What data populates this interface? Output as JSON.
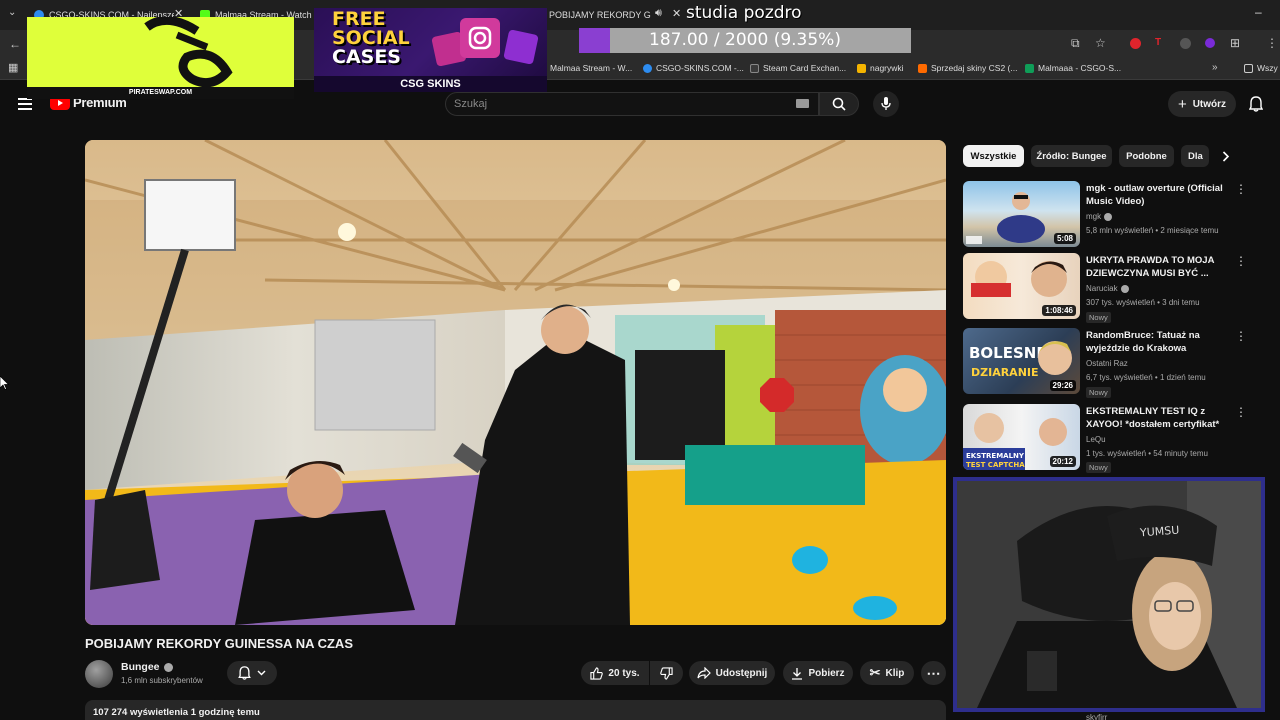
{
  "browser": {
    "tabs": [
      {
        "label": "CSGO-SKINS.COM - Najlepsze",
        "color": "#2d8cf0"
      },
      {
        "label": "Malmaa Stream - Watch Li",
        "color": "#53fc18"
      },
      {
        "label": "POBIJAMY REKORDY GUIN",
        "color": "#ff0000"
      }
    ],
    "bookmarks": [
      {
        "label": "Malmaa Stream - W...",
        "color": "#53fc18"
      },
      {
        "label": "CSGO-SKINS.COM -...",
        "color": "#2d8cf0"
      },
      {
        "label": "Steam Card Exchan...",
        "color": "#3a3a3a"
      },
      {
        "label": "nagrywki",
        "color": "#f4b400"
      },
      {
        "label": "Sprzedaj skiny CS2 (...",
        "color": "#ff6a00"
      },
      {
        "label": "Malmaaa - CSGO-S...",
        "color": "#0f9d58"
      }
    ],
    "bookmarks_more": "Wszy"
  },
  "youtube": {
    "logo_label": "Premium",
    "search_placeholder": "Szukaj",
    "create_label": "Utwórz",
    "video": {
      "title": "POBIJAMY REKORDY GUINESSA NA CZAS",
      "channel": "Bungee",
      "subscribers": "1,6 mln subskrybentów",
      "likes": "20 tys.",
      "share_label": "Udostępnij",
      "download_label": "Pobierz",
      "clip_label": "Klip",
      "views_line": "107 274 wyświetlenia  1 godzinę temu"
    },
    "chips": [
      "Wszystkie",
      "Źródło: Bungee",
      "Podobne",
      "Dla"
    ],
    "recommendations": [
      {
        "title": "mgk - outlaw overture (Official Music Video)",
        "channel": "mgk",
        "verified": true,
        "meta": "5,8 mln wyświetleń • 2 miesiące temu",
        "duration": "5:08",
        "badge": ""
      },
      {
        "title": "UKRYTA PRAWDA TO MOJA DZIEWCZYNA MUSI BYĆ ...",
        "channel": "Naruciak",
        "verified": true,
        "meta": "307 tys. wyświetleń • 3 dni temu",
        "duration": "1:08:46",
        "badge": "Nowy"
      },
      {
        "title": "RandomBruce: Tatuaż na wyjeździe do Krakowa (+Azdu...",
        "channel": "Ostatni Raz",
        "verified": false,
        "meta": "6,7 tys. wyświetleń • 1 dzień temu",
        "duration": "29:26",
        "badge": "Nowy"
      },
      {
        "title": "EKSTREMALNY TEST IQ z XAYOO! *dostałem certyfikat* ...",
        "channel": "LeQu",
        "verified": false,
        "meta": "1 tys. wyświetleń • 54 minuty temu",
        "duration": "20:12",
        "badge": "Nowy"
      }
    ],
    "rec_partial_channel": "skyfirr"
  },
  "overlay": {
    "message": "studia pozdro",
    "goal_text": "187.00 / 2000 (9.35%)",
    "goal_fraction": 0.0935,
    "ad_left_caption": "PIRATESWAP.COM",
    "ad_mid_line1": "FREE",
    "ad_mid_line2": "SOCIAL",
    "ad_mid_line3": "CASES",
    "ad_mid_brand": "CSG SKINS",
    "webcam_cap_text": "YUMSU"
  }
}
